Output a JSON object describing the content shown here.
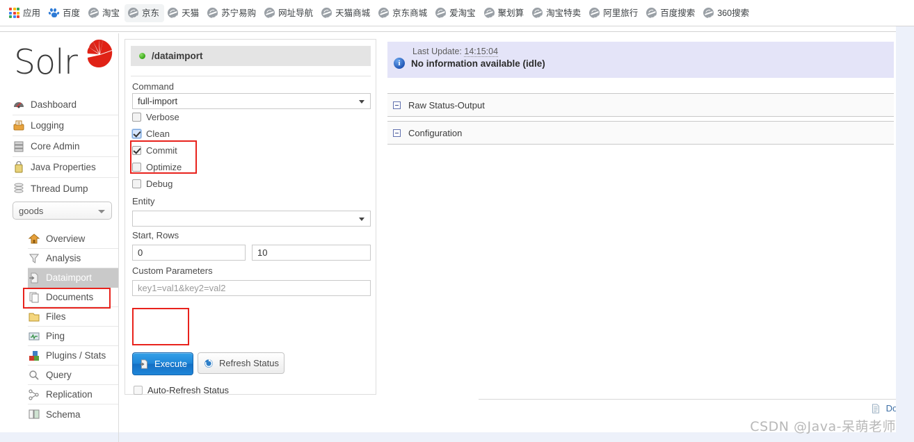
{
  "browser": {
    "bookmarks": [
      {
        "label": "应用",
        "icon": "apps-grid-icon",
        "focused": false
      },
      {
        "label": "百度",
        "icon": "baidu-icon",
        "focused": false
      },
      {
        "label": "淘宝",
        "icon": "globe-icon",
        "focused": false
      },
      {
        "label": "京东",
        "icon": "globe-icon",
        "focused": true
      },
      {
        "label": "天猫",
        "icon": "globe-icon",
        "focused": false
      },
      {
        "label": "苏宁易购",
        "icon": "globe-icon",
        "focused": false
      },
      {
        "label": "网址导航",
        "icon": "globe-icon",
        "focused": false
      },
      {
        "label": "天猫商城",
        "icon": "globe-icon",
        "focused": false
      },
      {
        "label": "京东商城",
        "icon": "globe-icon",
        "focused": false
      },
      {
        "label": "爱淘宝",
        "icon": "globe-icon",
        "focused": false
      },
      {
        "label": "聚划算",
        "icon": "globe-icon",
        "focused": false
      },
      {
        "label": "淘宝特卖",
        "icon": "globe-icon",
        "focused": false
      },
      {
        "label": "阿里旅行",
        "icon": "globe-icon",
        "focused": false
      },
      {
        "label": "百度搜索",
        "icon": "globe-icon",
        "focused": false
      },
      {
        "label": "360搜索",
        "icon": "globe-icon",
        "focused": false
      }
    ]
  },
  "sidebar": {
    "logo_text": "Solr",
    "logo_icon": "solr-sunburst-icon",
    "top_items": [
      {
        "label": "Dashboard",
        "icon": "dashboard-gauge-icon"
      },
      {
        "label": "Logging",
        "icon": "logging-tray-icon"
      },
      {
        "label": "Core Admin",
        "icon": "core-admin-server-icon"
      },
      {
        "label": "Java Properties",
        "icon": "java-properties-icon"
      },
      {
        "label": "Thread Dump",
        "icon": "thread-dump-stack-icon"
      }
    ],
    "core_selector": {
      "value": "goods",
      "icon": "chevron-down-icon"
    },
    "core_items": [
      {
        "label": "Overview",
        "icon": "overview-home-icon",
        "active": false
      },
      {
        "label": "Analysis",
        "icon": "analysis-funnel-icon",
        "active": false
      },
      {
        "label": "Dataimport",
        "icon": "dataimport-icon",
        "active": true
      },
      {
        "label": "Documents",
        "icon": "documents-icon",
        "active": false
      },
      {
        "label": "Files",
        "icon": "files-folder-icon",
        "active": false
      },
      {
        "label": "Ping",
        "icon": "ping-monitor-icon",
        "active": false
      },
      {
        "label": "Plugins / Stats",
        "icon": "plugins-blocks-icon",
        "active": false
      },
      {
        "label": "Query",
        "icon": "query-magnifier-icon",
        "active": false
      },
      {
        "label": "Replication",
        "icon": "replication-nodes-icon",
        "active": false
      },
      {
        "label": "Schema",
        "icon": "schema-book-icon",
        "active": false
      }
    ]
  },
  "dataimport": {
    "handler_name": "/dataimport",
    "handler_status_icon": "green-status-dot",
    "command_label": "Command",
    "command_value": "full-import",
    "command_caret_icon": "chevron-down-icon",
    "checkboxes": [
      {
        "label": "Verbose",
        "checked": false,
        "focused": false
      },
      {
        "label": "Clean",
        "checked": true,
        "focused": true
      },
      {
        "label": "Commit",
        "checked": true,
        "focused": false
      },
      {
        "label": "Optimize",
        "checked": false,
        "focused": false
      },
      {
        "label": "Debug",
        "checked": false,
        "focused": false
      }
    ],
    "entity_label": "Entity",
    "entity_value": "",
    "entity_caret_icon": "chevron-down-icon",
    "start_rows_label": "Start, Rows",
    "start_value": "0",
    "rows_value": "10",
    "custom_params_label": "Custom Parameters",
    "custom_params_placeholder": "key1=val1&key2=val2",
    "execute_label": "Execute",
    "execute_icon": "dataimport-icon",
    "refresh_label": "Refresh Status",
    "refresh_icon": "refresh-circular-arrow-icon",
    "auto_refresh_label": "Auto-Refresh Status",
    "auto_refresh_checked": false
  },
  "status": {
    "last_update_label": "Last Update:",
    "last_update_time": "14:15:04",
    "info_icon": "info-circle-icon",
    "message": "No information available (idle)",
    "accordions": [
      {
        "label": "Raw Status-Output",
        "icon": "collapse-minus-icon"
      },
      {
        "label": "Configuration",
        "icon": "collapse-minus-icon"
      }
    ]
  },
  "footer": {
    "documents_link_label": "Docume",
    "documents_link_icon": "document-page-icon",
    "watermark": "CSDN @Java-呆萌老师"
  },
  "annotations": {
    "color": "#e8221c",
    "boxes": [
      {
        "name": "clean-commit-highlight"
      },
      {
        "name": "dataimport-nav-highlight"
      },
      {
        "name": "execute-button-highlight"
      }
    ]
  },
  "colors": {
    "accent_blue": "#1f86d8",
    "status_panel": "#e4e4f8",
    "handler_bar": "#e4e4e4",
    "annotation_red": "#e8221c",
    "active_nav": "#c9c9c9"
  }
}
